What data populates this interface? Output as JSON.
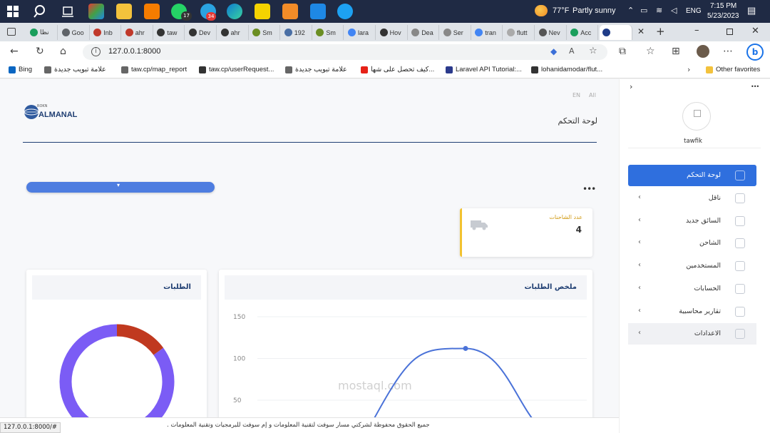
{
  "taskbar": {
    "weather_temp": "77°F",
    "weather_text": "Partly sunny",
    "lang": "ENG",
    "time": "7:15 PM",
    "date": "5/23/2023",
    "whatsapp_badge": "17",
    "telegram_badge": "34"
  },
  "tabs": [
    {
      "label": "نظا",
      "color": "#1a9e5c"
    },
    {
      "label": "Goo",
      "color": "#5f6368"
    },
    {
      "label": "Inb",
      "color": "#c0392b"
    },
    {
      "label": "ahr",
      "color": "#c0392b"
    },
    {
      "label": "taw",
      "color": "#333"
    },
    {
      "label": "Dev",
      "color": "#333"
    },
    {
      "label": "ahr",
      "color": "#333"
    },
    {
      "label": "Sm",
      "color": "#6b8e23"
    },
    {
      "label": "192",
      "color": "#4a6fa5"
    },
    {
      "label": "Sm",
      "color": "#6b8e23"
    },
    {
      "label": "lara",
      "color": "#4285f4"
    },
    {
      "label": "Hov",
      "color": "#333"
    },
    {
      "label": "Dea",
      "color": "#888"
    },
    {
      "label": "Ser",
      "color": "#888"
    },
    {
      "label": "tran",
      "color": "#4285f4"
    },
    {
      "label": "flutt",
      "color": "#aaa"
    },
    {
      "label": "Nev",
      "color": "#555"
    },
    {
      "label": "Acc",
      "color": "#1a9e5c"
    },
    {
      "label": "",
      "color": "#1f3c88"
    }
  ],
  "address": {
    "url": "127.0.0.1:8000"
  },
  "favorites": [
    {
      "label": "Bing",
      "color": "#0a66c2"
    },
    {
      "label": "علامة تبويب جديدة",
      "color": "#666"
    },
    {
      "label": "taw.cp/map_report",
      "color": "#666"
    },
    {
      "label": "taw.cp/userRequest...",
      "color": "#333"
    },
    {
      "label": "علامة تبويب جديدة",
      "color": "#666"
    },
    {
      "label": "كيف تحصل على شها...",
      "color": "#e62117"
    },
    {
      "label": "Laravel API Tutorial:...",
      "color": "#2b3a8c"
    },
    {
      "label": "lohanidamodar/flut...",
      "color": "#333"
    }
  ],
  "other_favorites": "Other favorites",
  "header": {
    "lang_en": "EN",
    "lang_all": "All",
    "brand_small": "ROKN",
    "brand_main": "ALMANAL",
    "page_title": "لوحة التحكم"
  },
  "stat_card": {
    "label": "عدد الشاحنات",
    "value": "4"
  },
  "summary_card": {
    "title": "ملخص الطلبات",
    "y_ticks": [
      "150",
      "100",
      "50"
    ]
  },
  "orders_card": {
    "title": "الطلبات"
  },
  "sidebar": {
    "username": "tawfik",
    "items": [
      {
        "label": "لوحة التحكم",
        "active": true
      },
      {
        "label": "ناقل",
        "active": false
      },
      {
        "label": "السائق جديد",
        "active": false
      },
      {
        "label": "الشاحن",
        "active": false
      },
      {
        "label": "المستخدمين",
        "active": false
      },
      {
        "label": "الحسابات",
        "active": false
      },
      {
        "label": "تقارير محاسبية",
        "active": false
      },
      {
        "label": "الاعدادات",
        "active": false
      }
    ]
  },
  "footer": {
    "text": "جميع الحقوق محفوظة لشركتي مسار سوفت لتقنية المعلومات و إم سوفت للبرمجيات وتقنية المعلومات .",
    "status_url": "127.0.0.1:8000/#"
  },
  "watermark": "mostaql.com",
  "colors": {
    "primary": "#2f6fde",
    "stat_accent": "#f2c230",
    "donut_purple": "#7b5cf5",
    "donut_red": "#c0391f",
    "line_blue": "#4a72d8"
  },
  "chart_data": [
    {
      "type": "line",
      "title": "ملخص الطلبات",
      "ylim": [
        0,
        150
      ],
      "y_ticks": [
        150,
        100,
        50
      ],
      "series": [
        {
          "values": [
            0,
            112,
            0
          ]
        }
      ]
    },
    {
      "type": "pie",
      "title": "الطلبات",
      "slices": [
        {
          "value": 0.15,
          "color": "#c0391f"
        },
        {
          "value": 0.85,
          "color": "#7b5cf5"
        }
      ]
    }
  ]
}
